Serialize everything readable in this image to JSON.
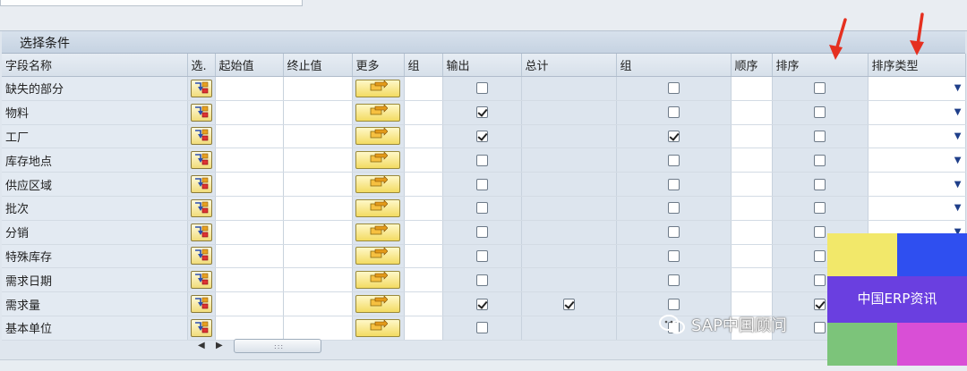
{
  "panel": {
    "title": "选择条件"
  },
  "columns": [
    "字段名称",
    "选.",
    "起始值",
    "终止值",
    "更多",
    "组",
    "输出",
    "总计",
    "组",
    "顺序",
    "排序",
    "排序类型"
  ],
  "rows": [
    {
      "name": "缺失的部分",
      "output": false,
      "total": false,
      "group": false,
      "sort": false
    },
    {
      "name": "物料",
      "output": true,
      "total": false,
      "group": false,
      "sort": false
    },
    {
      "name": "工厂",
      "output": true,
      "total": false,
      "group": true,
      "sort": false
    },
    {
      "name": "库存地点",
      "output": false,
      "total": false,
      "group": false,
      "sort": false
    },
    {
      "name": "供应区域",
      "output": false,
      "total": false,
      "group": false,
      "sort": false
    },
    {
      "name": "批次",
      "output": false,
      "total": false,
      "group": false,
      "sort": false
    },
    {
      "name": "分销",
      "output": false,
      "total": false,
      "group": false,
      "sort": false
    },
    {
      "name": "特殊库存",
      "output": false,
      "total": false,
      "group": false,
      "sort": false
    },
    {
      "name": "需求日期",
      "output": false,
      "total": false,
      "group": false,
      "sort": false
    },
    {
      "name": "需求量",
      "output": true,
      "total": true,
      "group": false,
      "sort": true
    },
    {
      "name": "基本单位",
      "output": false,
      "total": false,
      "group": false,
      "sort": false
    }
  ],
  "scrollbar": {
    "grip": ":::"
  },
  "watermark": {
    "text": "SAP中国顾问"
  },
  "badge": {
    "text": "中国ERP资讯"
  },
  "colors": {
    "arrow": "#e53020",
    "badge_yellow": "#f2e86a",
    "badge_blue": "#2f4ff0",
    "badge_green": "#7cc47a",
    "badge_magenta": "#d94fd6",
    "badge_band": "#6a3fe0"
  }
}
